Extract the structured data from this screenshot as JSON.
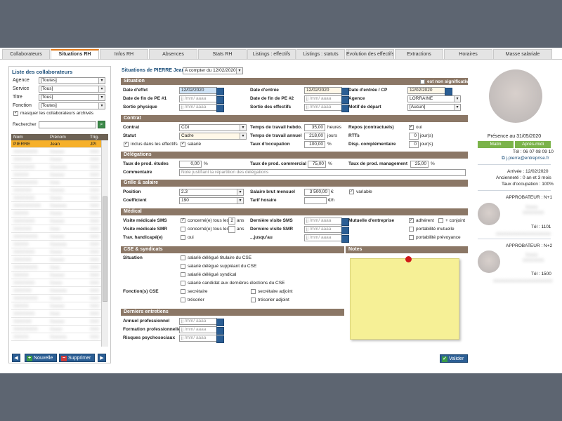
{
  "tabs": [
    "Collaborateurs",
    "Situations RH",
    "Infos RH",
    "Absences",
    "Stats RH",
    "Listings : effectifs",
    "Listings : statuts",
    "Évolution des effectifs",
    "Extractions",
    "Horaires",
    "Masse salariale"
  ],
  "left": {
    "title": "Liste des collaborateurs",
    "filters": [
      {
        "label": "Agence",
        "value": "[Toutes]"
      },
      {
        "label": "Service",
        "value": "[Tous]"
      },
      {
        "label": "Titre",
        "value": "[Tous]"
      },
      {
        "label": "Fonction",
        "value": "[Toutes]"
      }
    ],
    "masquer_label": "masquer les collaborateurs archivés",
    "rechercher_label": "Rechercher",
    "rechercher_value": "",
    "headers": {
      "nom": "Nom",
      "prenom": "Prénom",
      "trig": "Trig."
    },
    "selected_row": {
      "nom": "PIERRE",
      "prenom": "Jean",
      "trig": "JPI"
    },
    "buttons": {
      "nouvelle": "Nouvelle",
      "supprimer": "Supprimer"
    }
  },
  "main": {
    "header_label": "Situations de PIERRE Jean :",
    "header_select": "A compter du 12/02/2020",
    "sections": {
      "situation": "Situation",
      "contrat": "Contrat",
      "delegations": "Délégations",
      "grille": "Grille & salaire",
      "medical": "Médical",
      "cse": "CSE & syndicats",
      "notes": "Notes",
      "derniers": "Derniers entretiens"
    },
    "non_significative": "est non significative",
    "situation": {
      "date_effet": {
        "label": "Date d'effet",
        "value": "12/02/2020"
      },
      "date_entree": {
        "label": "Date d'entrée",
        "value": "12/02/2020"
      },
      "date_entree_cp": {
        "label": "Date d'entrée / CP",
        "value": "12/02/2020"
      },
      "fin_pe1": {
        "label": "Date de fin de PE #1",
        "value": "jj /mm/ aaaa"
      },
      "fin_pe2": {
        "label": "Date de fin de PE #2",
        "value": "jj /mm/ aaaa"
      },
      "agence": {
        "label": "Agence",
        "value": "LORRAINE"
      },
      "sortie_physique": {
        "label": "Sortie physique",
        "value": "jj /mm/ aaaa"
      },
      "sortie_effectifs": {
        "label": "Sortie des effectifs",
        "value": "jj /mm/ aaaa"
      },
      "motif": {
        "label": "Motif de départ",
        "value": "[Aucun]"
      }
    },
    "contrat": {
      "contrat": {
        "label": "Contrat",
        "value": "CDI"
      },
      "statut": {
        "label": "Statut",
        "value": "Cadre"
      },
      "inclus": "inclus dans les effectifs",
      "salarie": "salarié",
      "temps_hebdo": {
        "label": "Temps de travail hebdo.",
        "value": "35,00",
        "unit": "heures"
      },
      "temps_annuel": {
        "label": "Temps de travail annuel",
        "value": "218,00",
        "unit": "jours"
      },
      "taux_occ": {
        "label": "Taux d'occupation",
        "value": "100,00",
        "unit": "%"
      },
      "repos": {
        "label": "Repos (contractuels)",
        "value": "oui"
      },
      "rtt": {
        "label": "RTTs",
        "value": "0",
        "unit": "jour(s)"
      },
      "disp": {
        "label": "Disp. complémentaire",
        "value": "0",
        "unit": "jour(s)"
      }
    },
    "delegations": {
      "taux_etudes": {
        "label": "Taux de prod. études",
        "value": "0,00",
        "unit": "%"
      },
      "taux_commercial": {
        "label": "Taux de prod. commercial",
        "value": "75,00",
        "unit": "%"
      },
      "taux_management": {
        "label": "Taux de prod. management",
        "value": "25,00",
        "unit": "%"
      },
      "commentaire": {
        "label": "Commentaire",
        "placeholder": "Note justifiant la répartition des délégations"
      }
    },
    "grille": {
      "position": {
        "label": "Position",
        "value": "2.3"
      },
      "coefficient": {
        "label": "Coefficient",
        "value": "190"
      },
      "salaire": {
        "label": "Salaire brut mensuel",
        "value": "3 500,00",
        "unit": "€"
      },
      "variable": "variable",
      "tarif": {
        "label": "Tarif horaire",
        "value": "",
        "unit": "€/h"
      }
    },
    "medical": {
      "visite_sms": {
        "label": "Visite médicale SMS",
        "check": "concerné(e) tous les",
        "years": "2",
        "unit": "ans"
      },
      "visite_smr": {
        "label": "Visite médicale SMR",
        "check": "concerné(e) tous les",
        "years": "",
        "unit": "ans"
      },
      "handicap": {
        "label": "Trav. handicapé(e)",
        "check": "oui"
      },
      "derniere_sms": {
        "label": "Dernière visite SMS",
        "value": "jj /mm/ aaaa"
      },
      "derniere_smr": {
        "label": "Dernière visite SMR",
        "value": "jj /mm/ aaaa"
      },
      "jusqu_au": {
        "label": "...jusqu'au",
        "value": "jj /mm/ aaaa"
      },
      "mutuelle": {
        "label": "Mutuelle d'entreprise",
        "adherent": "adhérent",
        "conjoint": "+ conjoint",
        "portabilite": "portabilité mutuelle",
        "prevoyance": "portabilité prévoyance"
      }
    },
    "cse": {
      "situation_label": "Situation",
      "options": [
        "salarié délégué titulaire du CSE",
        "salarié délégué suppléant du CSE",
        "salarié délégué syndical",
        "salarié candidat aux dernières élections du CSE"
      ],
      "fonction_label": "Fonction(s) CSE",
      "fonctions": [
        "secrétaire",
        "secrétaire adjoint",
        "trésorier",
        "trésorier adjoint"
      ]
    },
    "derniers": [
      {
        "label": "Annuel professionnel",
        "value": "jj /mm/ aaaa"
      },
      {
        "label": "Formation professionnelle",
        "value": "jj /mm/ aaaa"
      },
      {
        "label": "Risques psychosociaux",
        "value": "jj /mm/ aaaa"
      }
    ],
    "valider": "Valider"
  },
  "right": {
    "presence": "Présence au 31/05/2020",
    "matin": "Matin",
    "apres_midi": "Après-midi",
    "tel": "Tél : 06 07 08 09 10",
    "email": "j.pierre@entreprise.fr",
    "arrivee": "Arrivée : 12/02/2020",
    "anciennete": "Ancienneté : 0 an et 3 mois",
    "taux": "Taux d'occupation : 100%",
    "approbateurs": [
      {
        "title": "APPROBATEUR : N+1",
        "tel": "Tél : 1101"
      },
      {
        "title": "APPROBATEUR : N+2",
        "tel": "Tél : 1500"
      }
    ]
  },
  "colors": {
    "accent": "#2b5e94",
    "section": "#8b7766",
    "selected": "#f6b02a",
    "presence": "#7bb34a"
  }
}
